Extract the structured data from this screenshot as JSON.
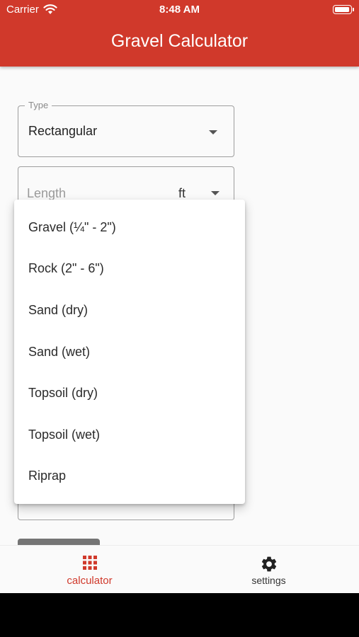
{
  "status_bar": {
    "carrier": "Carrier",
    "time": "8:48 AM"
  },
  "app_bar": {
    "title": "Gravel Calculator"
  },
  "form": {
    "type_field": {
      "legend": "Type",
      "value": "Rectangular"
    },
    "length_field": {
      "placeholder": "Length",
      "unit": "ft"
    }
  },
  "dropdown": {
    "items": [
      {
        "label": "Gravel (¼\" - 2\")"
      },
      {
        "label": "Rock (2\" - 6\")"
      },
      {
        "label": "Sand (dry)"
      },
      {
        "label": "Sand (wet)"
      },
      {
        "label": "Topsoil (dry)"
      },
      {
        "label": "Topsoil (wet)"
      },
      {
        "label": "Riprap"
      }
    ]
  },
  "bottom_nav": {
    "calculator_label": "calculator",
    "settings_label": "settings"
  },
  "colors": {
    "primary": "#d0392b",
    "background": "#fafafa",
    "text": "#222222"
  },
  "icons": {
    "calculator": "grid-icon",
    "settings": "gear-icon",
    "wifi": "wifi-icon",
    "battery": "battery-icon"
  }
}
